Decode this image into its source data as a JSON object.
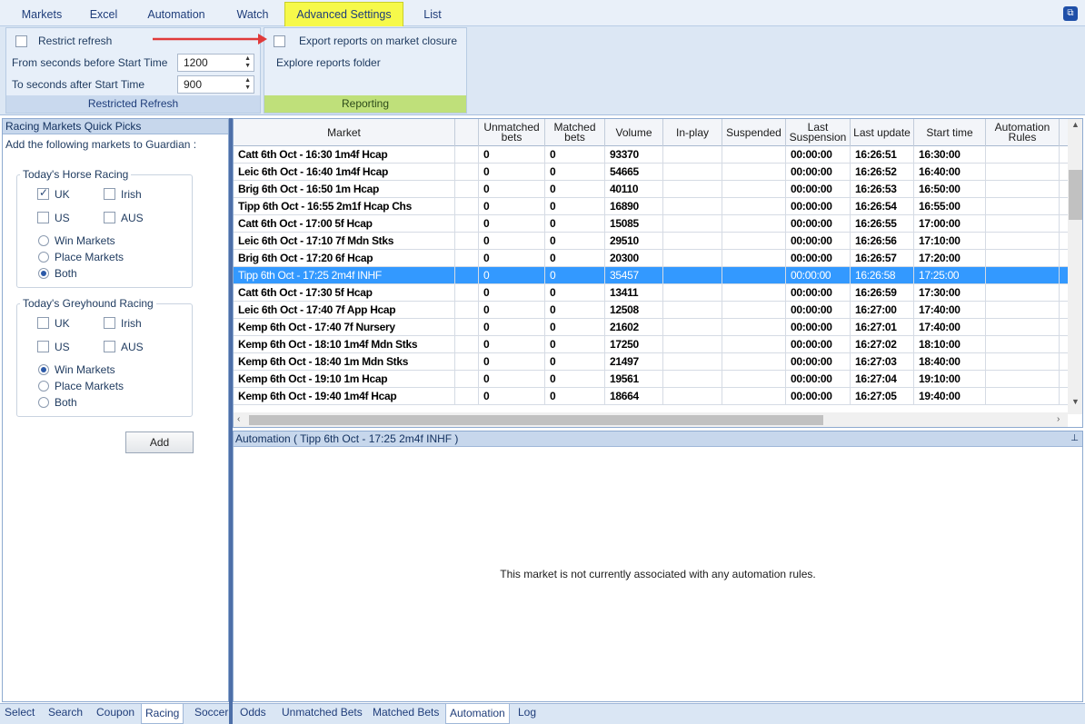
{
  "menu": {
    "tabs": [
      "Markets",
      "Excel",
      "Automation",
      "Watch",
      "Advanced Settings",
      "List"
    ],
    "active": "Advanced Settings"
  },
  "ribbon": {
    "restricted_refresh": {
      "restrict_label": "Restrict refresh",
      "restrict_checked": false,
      "from_label": "From seconds before Start Time",
      "from_value": "1200",
      "to_label": "To seconds after Start Time",
      "to_value": "900",
      "group_title": "Restricted Refresh"
    },
    "reporting": {
      "export_label": "Export reports on market closure",
      "export_checked": false,
      "explore_label": "Explore reports folder",
      "group_title": "Reporting"
    }
  },
  "left": {
    "header": "Racing Markets Quick Picks",
    "intro": "Add the following markets to Guardian :",
    "horse": {
      "title": "Today's Horse Racing",
      "uk": "UK",
      "irish": "Irish",
      "us": "US",
      "aus": "AUS",
      "win": "Win Markets",
      "place": "Place Markets",
      "both": "Both"
    },
    "greyhound": {
      "title": "Today's Greyhound Racing",
      "uk": "UK",
      "irish": "Irish",
      "us": "US",
      "aus": "AUS",
      "win": "Win Markets",
      "place": "Place Markets",
      "both": "Both"
    },
    "add_label": "Add",
    "bottom_tabs": [
      "Select",
      "Search",
      "Coupon",
      "Racing",
      "Soccer"
    ],
    "active_tab": "Racing"
  },
  "grid": {
    "columns": [
      "Market",
      "",
      "Unmatched bets",
      "Matched bets",
      "Volume",
      "In-play",
      "Suspended",
      "Last Suspension",
      "Last update",
      "Start time",
      "Automation Rules"
    ],
    "rows": [
      [
        "Catt 6th Oct - 16:30 1m4f Hcap",
        "",
        "0",
        "0",
        "93370",
        "",
        "",
        "00:00:00",
        "16:26:51",
        "16:30:00",
        ""
      ],
      [
        "Leic 6th Oct - 16:40 1m4f Hcap",
        "",
        "0",
        "0",
        "54665",
        "",
        "",
        "00:00:00",
        "16:26:52",
        "16:40:00",
        ""
      ],
      [
        "Brig 6th Oct - 16:50 1m Hcap",
        "",
        "0",
        "0",
        "40110",
        "",
        "",
        "00:00:00",
        "16:26:53",
        "16:50:00",
        ""
      ],
      [
        "Tipp 6th Oct - 16:55 2m1f Hcap Chs",
        "",
        "0",
        "0",
        "16890",
        "",
        "",
        "00:00:00",
        "16:26:54",
        "16:55:00",
        ""
      ],
      [
        "Catt 6th Oct - 17:00 5f Hcap",
        "",
        "0",
        "0",
        "15085",
        "",
        "",
        "00:00:00",
        "16:26:55",
        "17:00:00",
        ""
      ],
      [
        "Leic 6th Oct - 17:10 7f Mdn Stks",
        "",
        "0",
        "0",
        "29510",
        "",
        "",
        "00:00:00",
        "16:26:56",
        "17:10:00",
        ""
      ],
      [
        "Brig 6th Oct - 17:20 6f Hcap",
        "",
        "0",
        "0",
        "20300",
        "",
        "",
        "00:00:00",
        "16:26:57",
        "17:20:00",
        ""
      ],
      [
        "Tipp 6th Oct - 17:25 2m4f INHF",
        "",
        "0",
        "0",
        "35457",
        "",
        "",
        "00:00:00",
        "16:26:58",
        "17:25:00",
        ""
      ],
      [
        "Catt 6th Oct - 17:30 5f Hcap",
        "",
        "0",
        "0",
        "13411",
        "",
        "",
        "00:00:00",
        "16:26:59",
        "17:30:00",
        ""
      ],
      [
        "Leic 6th Oct - 17:40 7f App Hcap",
        "",
        "0",
        "0",
        "12508",
        "",
        "",
        "00:00:00",
        "16:27:00",
        "17:40:00",
        ""
      ],
      [
        "Kemp 6th Oct - 17:40 7f Nursery",
        "",
        "0",
        "0",
        "21602",
        "",
        "",
        "00:00:00",
        "16:27:01",
        "17:40:00",
        ""
      ],
      [
        "Kemp 6th Oct - 18:10 1m4f Mdn Stks",
        "",
        "0",
        "0",
        "17250",
        "",
        "",
        "00:00:00",
        "16:27:02",
        "18:10:00",
        ""
      ],
      [
        "Kemp 6th Oct - 18:40 1m Mdn Stks",
        "",
        "0",
        "0",
        "21497",
        "",
        "",
        "00:00:00",
        "16:27:03",
        "18:40:00",
        ""
      ],
      [
        "Kemp 6th Oct - 19:10 1m Hcap",
        "",
        "0",
        "0",
        "19561",
        "",
        "",
        "00:00:00",
        "16:27:04",
        "19:10:00",
        ""
      ],
      [
        "Kemp 6th Oct - 19:40 1m4f Hcap",
        "",
        "0",
        "0",
        "18664",
        "",
        "",
        "00:00:00",
        "16:27:05",
        "19:40:00",
        ""
      ]
    ],
    "selected_index": 7
  },
  "automation": {
    "header": "Automation ( Tipp 6th Oct - 17:25 2m4f INHF )",
    "message": "This market is not currently associated with any automation rules.",
    "bottom_tabs": [
      "Odds",
      "Unmatched Bets",
      "Matched Bets",
      "Automation",
      "Log"
    ],
    "active_tab": "Automation"
  },
  "colors": {
    "active_tab": "#f6f94a",
    "selection": "#3399ff",
    "arrow": "#e03a3a"
  }
}
